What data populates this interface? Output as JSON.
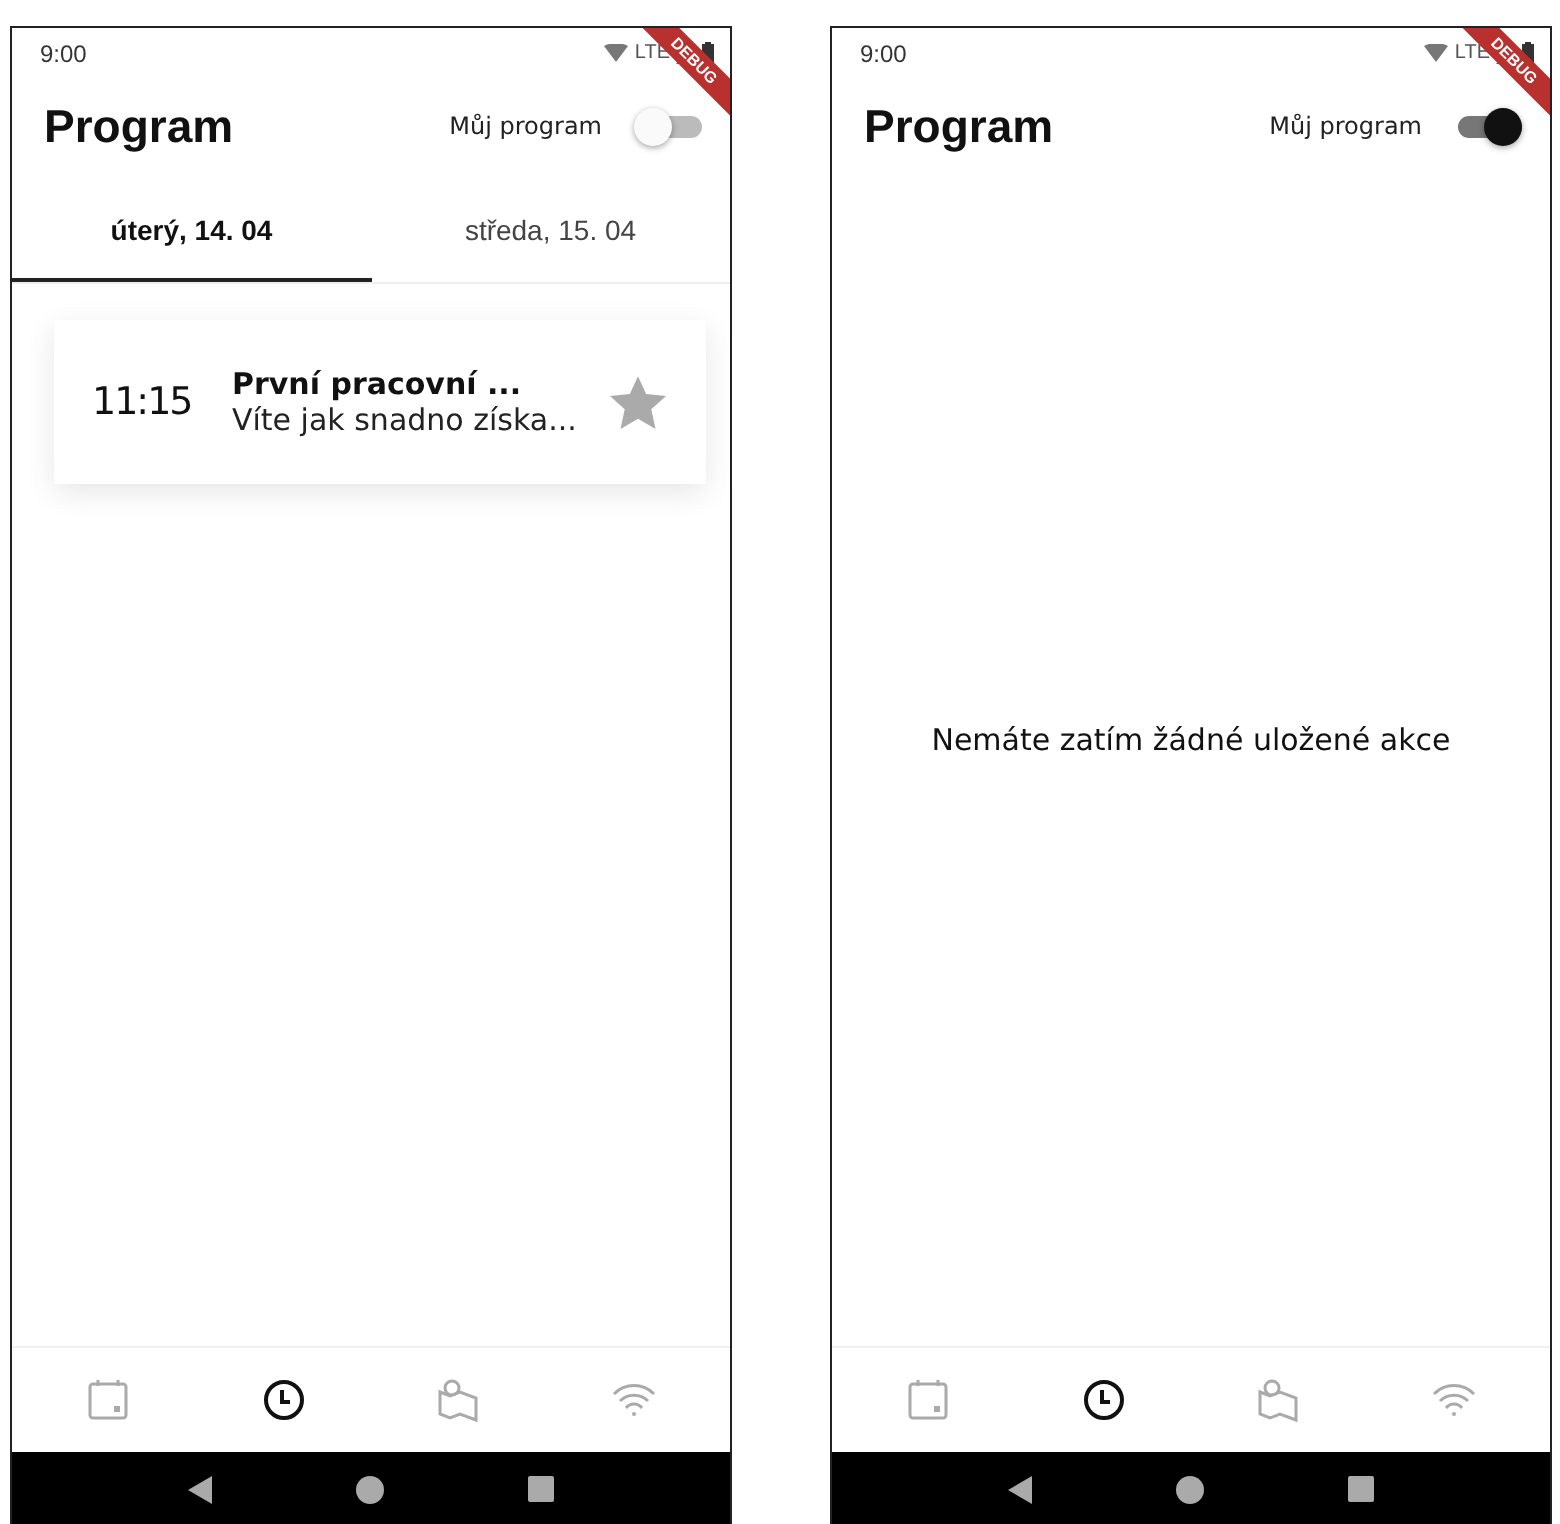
{
  "screens": [
    {
      "status_time": "9:00",
      "status_network": "LTE",
      "debug_banner": "DEBUG",
      "title": "Program",
      "toggle_label": "Můj program",
      "my_program_on": false,
      "tabs": [
        {
          "label": "úterý, 14. 04",
          "selected": true
        },
        {
          "label": "středa, 15. 04",
          "selected": false
        }
      ],
      "events": [
        {
          "time": "11:15",
          "title": "První pracovní ...",
          "subtitle": "Víte jak snadno získa...",
          "starred": false
        }
      ],
      "nav_items": [
        {
          "kind": "calendar",
          "selected": false
        },
        {
          "kind": "clock",
          "selected": true
        },
        {
          "kind": "map",
          "selected": false
        },
        {
          "kind": "wifi",
          "selected": false
        }
      ]
    },
    {
      "status_time": "9:00",
      "status_network": "LTE",
      "debug_banner": "DEBUG",
      "title": "Program",
      "toggle_label": "Můj program",
      "my_program_on": true,
      "empty_message": "Nemáte zatím žádné uložené akce",
      "nav_items": [
        {
          "kind": "calendar",
          "selected": false
        },
        {
          "kind": "clock",
          "selected": true
        },
        {
          "kind": "map",
          "selected": false
        },
        {
          "kind": "wifi",
          "selected": false
        }
      ]
    }
  ]
}
